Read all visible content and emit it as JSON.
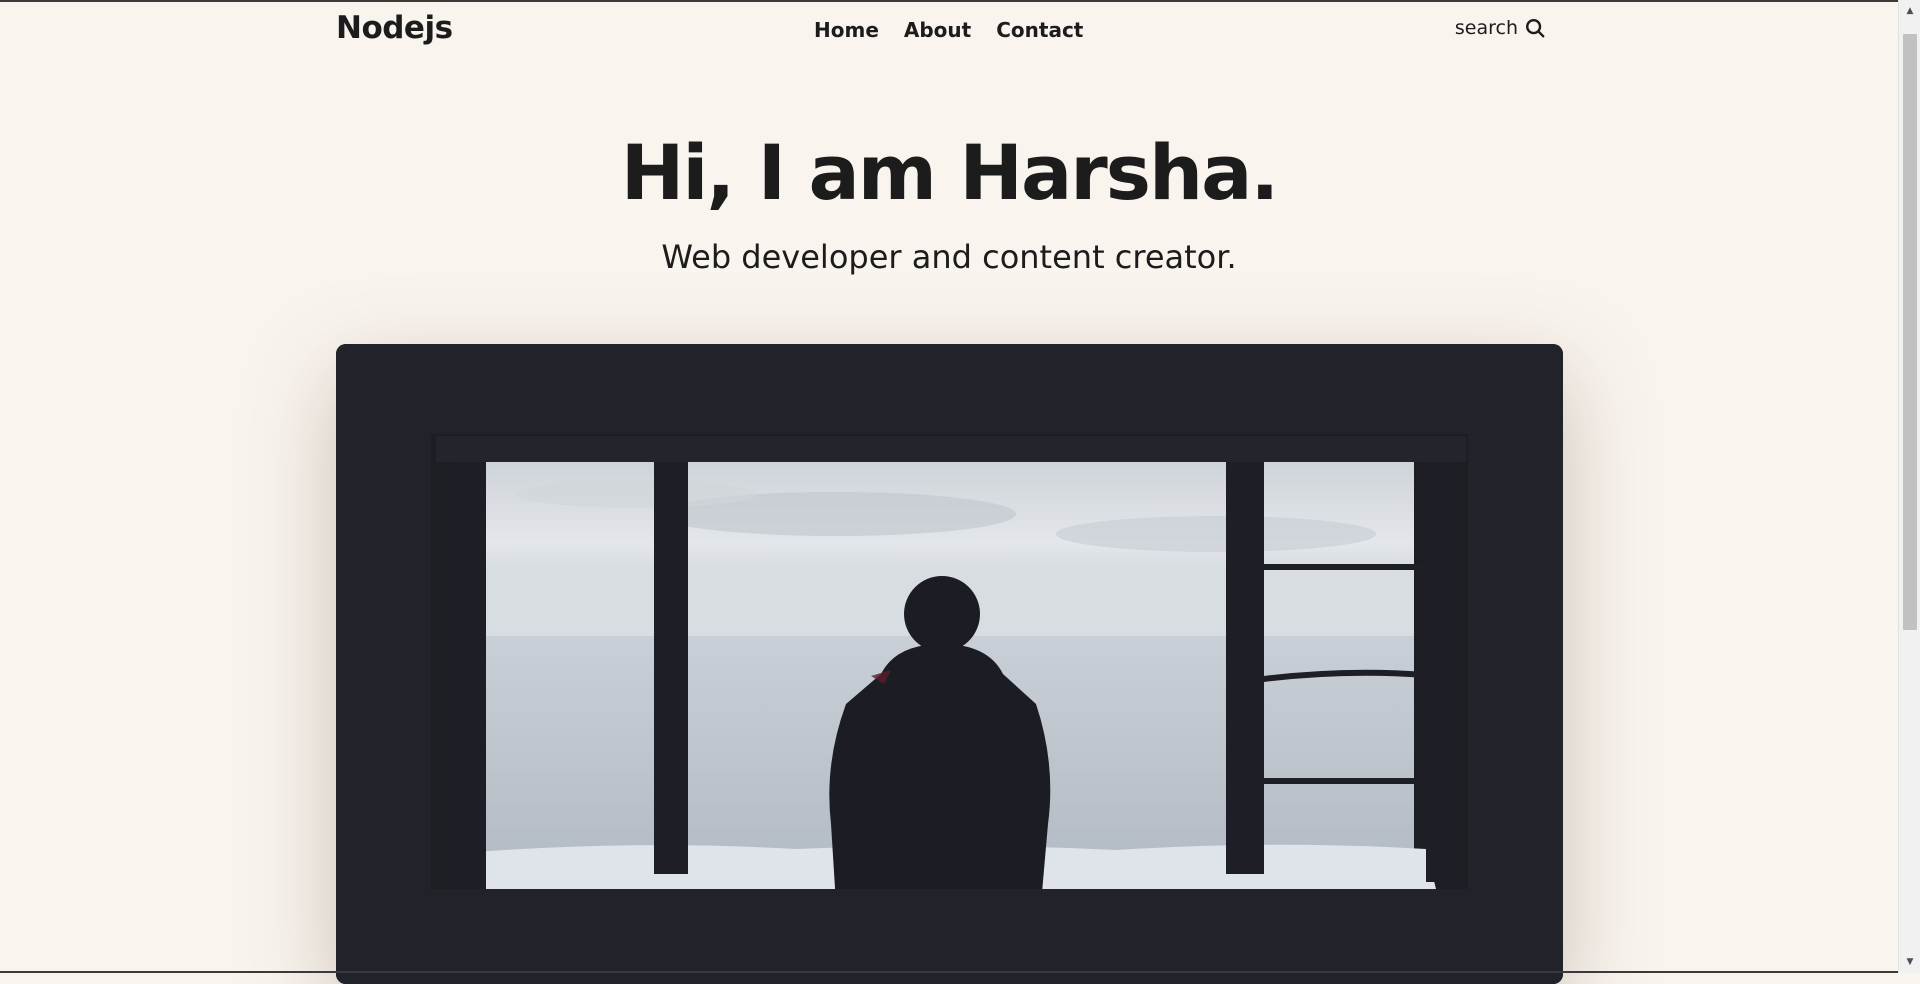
{
  "header": {
    "logo": "Nodejs",
    "nav": [
      {
        "label": "Home"
      },
      {
        "label": "About"
      },
      {
        "label": "Contact"
      }
    ],
    "search_label": "search"
  },
  "hero": {
    "title": "Hi, I am Harsha.",
    "subtitle": "Web developer and content creator."
  },
  "icons": {
    "search": "search-icon",
    "scroll_up": "chevron-up-icon",
    "scroll_down": "chevron-down-icon"
  },
  "colors": {
    "background": "#f9f4ee",
    "text": "#1c1c1c",
    "image_frame": "#22222b"
  }
}
